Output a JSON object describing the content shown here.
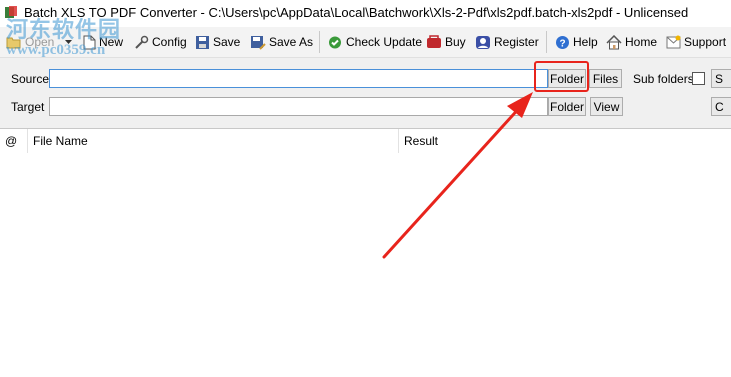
{
  "window": {
    "title": "Batch XLS TO PDF Converter - C:\\Users\\pc\\AppData\\Local\\Batchwork\\Xls-2-Pdf\\xls2pdf.batch-xls2pdf - Unlicensed"
  },
  "toolbar": {
    "open_label": "Open",
    "new_label": "New",
    "config_label": "Config",
    "save_label": "Save",
    "save_as_label": "Save As",
    "check_update_label": "Check Update",
    "buy_label": "Buy",
    "register_label": "Register",
    "help_label": "Help",
    "home_label": "Home",
    "support_label": "Support"
  },
  "form": {
    "source_label": "Source",
    "source_value": "",
    "source_folder_button": "Folder",
    "source_files_button": "Files",
    "subfolders_label": "Sub folders",
    "subfolders_checked": false,
    "target_label": "Target",
    "target_value": "",
    "target_folder_button": "Folder",
    "target_view_button": "View",
    "right_button_1": "S",
    "right_button_2": "C"
  },
  "table": {
    "columns": [
      "@",
      "File Name",
      "Result"
    ],
    "rows": []
  },
  "watermark": {
    "text_cn": "河东软件园",
    "text_url": "www.pc0359.cn"
  },
  "annotation": {
    "color": "#e8241c"
  }
}
